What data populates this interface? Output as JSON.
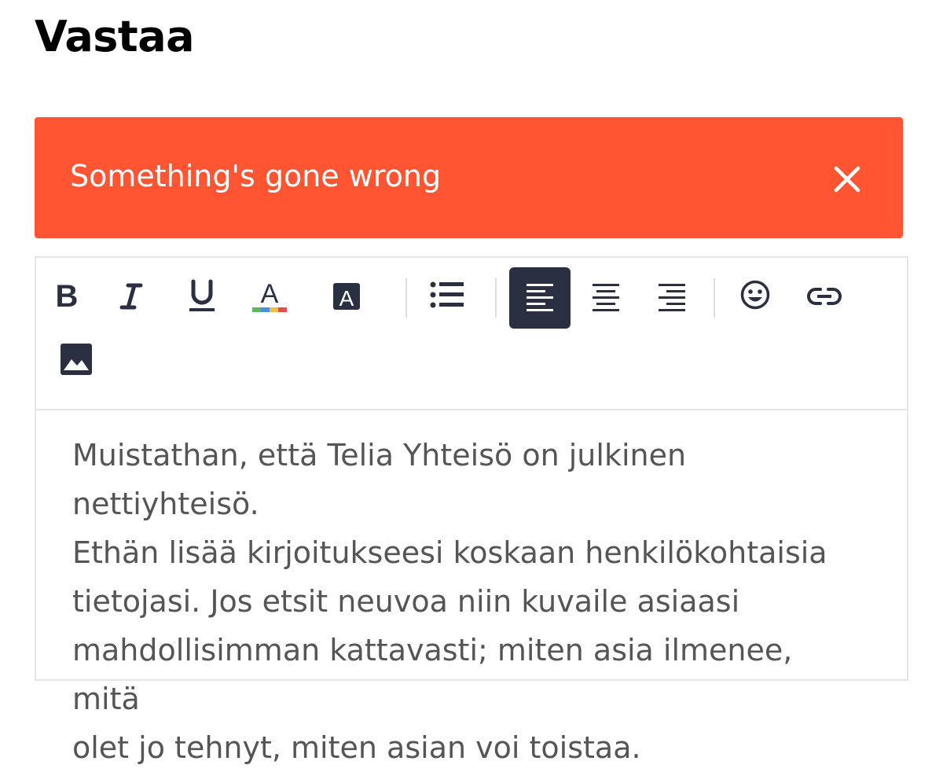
{
  "page": {
    "title": "Vastaa"
  },
  "alert": {
    "message": "Something's gone wrong",
    "close_icon": "close-icon",
    "background": "#ff5533"
  },
  "toolbar": {
    "buttons": [
      {
        "name": "bold",
        "icon": "bold-icon"
      },
      {
        "name": "italic",
        "icon": "italic-icon"
      },
      {
        "name": "underline",
        "icon": "underline-icon"
      },
      {
        "name": "font-color",
        "icon": "font-color-icon"
      },
      {
        "name": "background-color",
        "icon": "background-color-icon"
      },
      {
        "name": "bullet-list",
        "icon": "bulleted-list-icon"
      },
      {
        "name": "align-left",
        "icon": "align-left-icon",
        "active": true
      },
      {
        "name": "align-center",
        "icon": "align-center-icon"
      },
      {
        "name": "align-right",
        "icon": "align-right-icon"
      },
      {
        "name": "emoji",
        "icon": "smiley-icon"
      },
      {
        "name": "link",
        "icon": "link-icon"
      },
      {
        "name": "image",
        "icon": "image-icon"
      }
    ],
    "active_color": "#2a3042"
  },
  "editor": {
    "placeholder_lines": [
      "Muistathan, että Telia Yhteisö on julkinen nettiyhteisö.",
      "Ethän lisää kirjoitukseesi koskaan henkilökohtaisia",
      "tietojasi. Jos etsit neuvoa niin kuvaile asiaasi",
      "mahdollisimman kattavasti; miten asia ilmenee, mitä",
      "olet jo tehnyt, miten asian voi toistaa."
    ]
  }
}
